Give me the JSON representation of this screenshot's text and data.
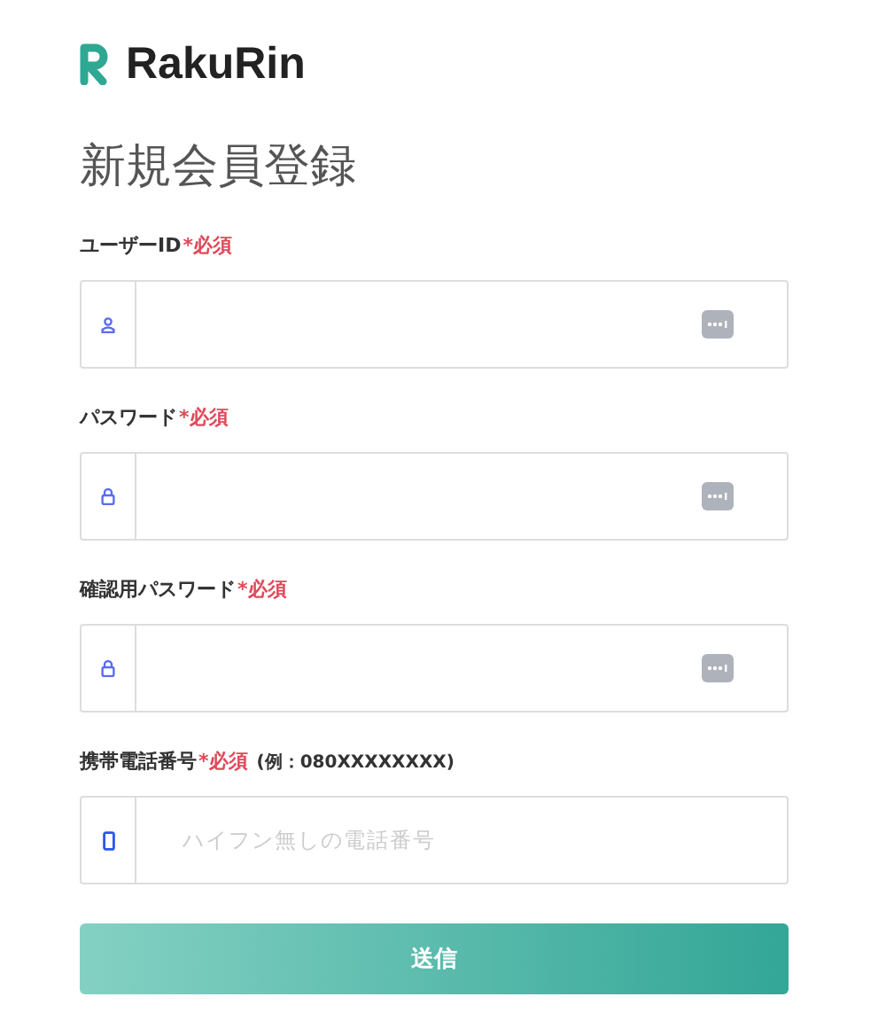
{
  "logo": {
    "text": "RakuRin"
  },
  "title": "新規会員登録",
  "fields": [
    {
      "label": "ユーザーID",
      "required": "*必須",
      "kind": "user",
      "autofill": true
    },
    {
      "label": "パスワード",
      "required": "*必須",
      "kind": "lock",
      "autofill": true
    },
    {
      "label": "確認用パスワード",
      "required": "*必須",
      "kind": "lock",
      "autofill": true
    },
    {
      "label": "携帯電話番号",
      "required": "*必須",
      "hint": "(例：080XXXXXXXX)",
      "kind": "phone",
      "autofill": false,
      "placeholder": "ハイフン無しの電話番号"
    }
  ],
  "submit": "送信"
}
